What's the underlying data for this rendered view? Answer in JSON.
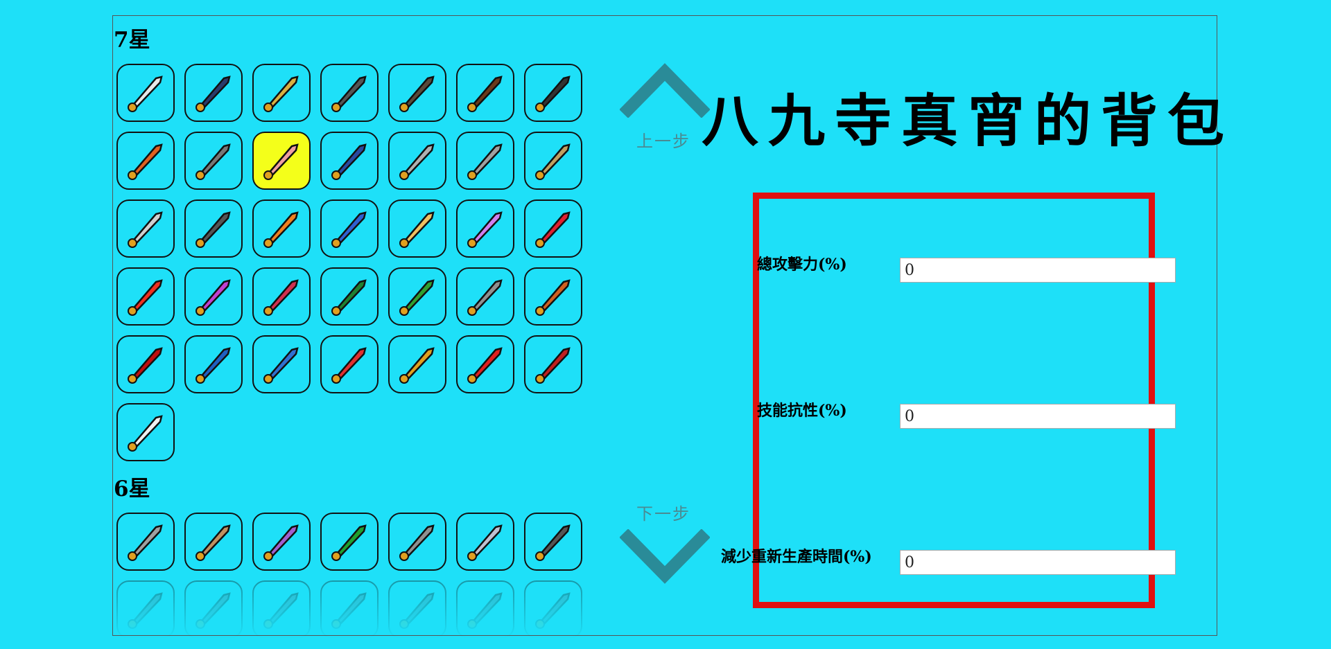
{
  "title": "八九寺真宵的背包",
  "nav": {
    "prev_label": "上一步",
    "next_label": "下一步"
  },
  "sections": [
    {
      "label": "7星",
      "items": [
        {
          "name": "white-scimitar-icon",
          "color": "#e8e8e8"
        },
        {
          "name": "black-glaive-icon",
          "color": "#2a3a6a"
        },
        {
          "name": "golden-saber-icon",
          "color": "#d8b040"
        },
        {
          "name": "dark-katana-icon",
          "color": "#555555"
        },
        {
          "name": "cannon-icon",
          "color": "#5a4a3a"
        },
        {
          "name": "wooden-launcher-icon",
          "color": "#6a3a1a"
        },
        {
          "name": "black-knife-icon",
          "color": "#333333"
        },
        {
          "name": "stapler-icon",
          "color": "#e06020"
        },
        {
          "name": "long-blade-icon",
          "color": "#777777"
        },
        {
          "name": "pig-icon",
          "color": "#f0a0a0",
          "highlight": true
        },
        {
          "name": "blue-spear-icon",
          "color": "#2a4aa0"
        },
        {
          "name": "silver-spear-icon",
          "color": "#b0b0b0"
        },
        {
          "name": "trident-icon",
          "color": "#a0a0a0"
        },
        {
          "name": "pickaxe-sword-icon",
          "color": "#c0a060"
        },
        {
          "name": "crossed-swords-icon",
          "color": "#d0d0d0"
        },
        {
          "name": "kunai-icon",
          "color": "#555555"
        },
        {
          "name": "water-gun-orange-icon",
          "color": "#f08020"
        },
        {
          "name": "water-gun-blue-icon",
          "color": "#3060d0"
        },
        {
          "name": "ice-cream-cone-icon",
          "color": "#f0c060"
        },
        {
          "name": "ice-cream-bag-icon",
          "color": "#d080f0"
        },
        {
          "name": "strawberry-staff-icon",
          "color": "#e02030"
        },
        {
          "name": "fire-rocket-icon",
          "color": "#f03020"
        },
        {
          "name": "toy-hammer-icon",
          "color": "#c040d0"
        },
        {
          "name": "skull-blaster-icon",
          "color": "#d03050"
        },
        {
          "name": "frog-hammer-icon",
          "color": "#208030"
        },
        {
          "name": "green-bazooka-icon",
          "color": "#30a030"
        },
        {
          "name": "shield-hammer-icon",
          "color": "#909090"
        },
        {
          "name": "festive-staff-icon",
          "color": "#d06020"
        },
        {
          "name": "red-lantern-club-icon",
          "color": "#c01010"
        },
        {
          "name": "paper-umbrella-icon",
          "color": "#2060c0"
        },
        {
          "name": "blue-rocket-icon",
          "color": "#3070d0"
        },
        {
          "name": "candy-cane-icon",
          "color": "#e03030"
        },
        {
          "name": "golden-sword-icon",
          "color": "#e0a020"
        },
        {
          "name": "kendama-icon",
          "color": "#e02020"
        },
        {
          "name": "red-pipe-icon",
          "color": "#c02020"
        },
        {
          "name": "bone-icon",
          "color": "#f0f0f0"
        }
      ]
    },
    {
      "label": "6星",
      "items": [
        {
          "name": "scroll-stamp-icon",
          "color": "#a0a0a0"
        },
        {
          "name": "boomerang-icon",
          "color": "#c09060"
        },
        {
          "name": "purple-sword-icon",
          "color": "#a060d0"
        },
        {
          "name": "green-swirl-icon",
          "color": "#20a030"
        },
        {
          "name": "chess-knight-icon",
          "color": "#909090"
        },
        {
          "name": "coffee-mug-icon",
          "color": "#c0c0d0"
        },
        {
          "name": "dark-cannon-icon",
          "color": "#555555"
        },
        {
          "name": "faded-gun-icon",
          "color": "#507080"
        },
        {
          "name": "faded-wand-icon",
          "color": "#507080"
        },
        {
          "name": "faded-staff-icon",
          "color": "#507080"
        },
        {
          "name": "faded-rod-icon",
          "color": "#507080"
        },
        {
          "name": "faded-scythe-icon",
          "color": "#507080"
        },
        {
          "name": "faded-blade-icon",
          "color": "#507080"
        },
        {
          "name": "faded-pacifier-icon",
          "color": "#507080"
        }
      ]
    }
  ],
  "stats": [
    {
      "label": "總攻擊力(%)",
      "value": "0"
    },
    {
      "label": "技能抗性(%)",
      "value": "0"
    },
    {
      "label": "減少重新生產時間(%)",
      "value": "0"
    }
  ],
  "colors": {
    "background": "#1ee0f8",
    "highlight_box": "#e01010",
    "item_highlight": "#f4ff1a",
    "nav_text": "#4a8a92"
  }
}
